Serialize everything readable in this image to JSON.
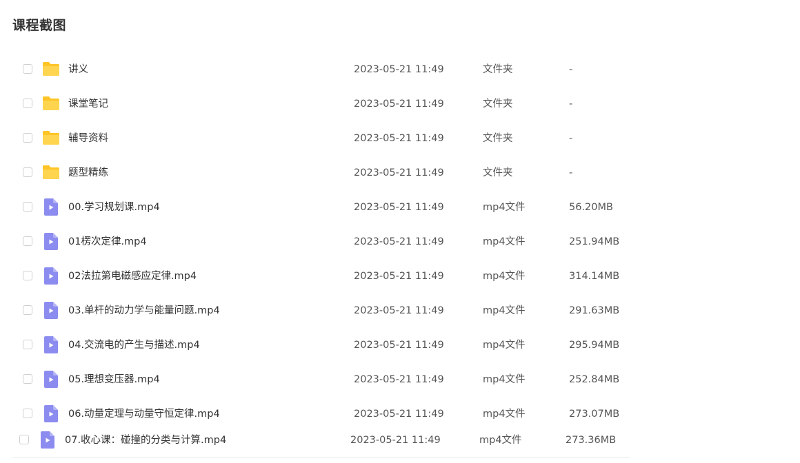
{
  "section": {
    "title": "课程截图"
  },
  "icons": {
    "folder": "folder-icon",
    "video": "video-file-icon",
    "folder_color": "#FFCA28",
    "video_color": "#8C8CF0"
  },
  "files": [
    {
      "name": "讲义",
      "date": "2023-05-21 11:49",
      "type": "文件夹",
      "size": "-",
      "kind": "folder"
    },
    {
      "name": "课堂笔记",
      "date": "2023-05-21 11:49",
      "type": "文件夹",
      "size": "-",
      "kind": "folder"
    },
    {
      "name": "辅导资料",
      "date": "2023-05-21 11:49",
      "type": "文件夹",
      "size": "-",
      "kind": "folder"
    },
    {
      "name": "题型精练",
      "date": "2023-05-21 11:49",
      "type": "文件夹",
      "size": "-",
      "kind": "folder"
    },
    {
      "name": "00.学习规划课.mp4",
      "date": "2023-05-21 11:49",
      "type": "mp4文件",
      "size": "56.20MB",
      "kind": "video"
    },
    {
      "name": "01楞次定律.mp4",
      "date": "2023-05-21 11:49",
      "type": "mp4文件",
      "size": "251.94MB",
      "kind": "video"
    },
    {
      "name": "02法拉第电磁感应定律.mp4",
      "date": "2023-05-21 11:49",
      "type": "mp4文件",
      "size": "314.14MB",
      "kind": "video"
    },
    {
      "name": "03.单杆的动力学与能量问题.mp4",
      "date": "2023-05-21 11:49",
      "type": "mp4文件",
      "size": "291.63MB",
      "kind": "video"
    },
    {
      "name": "04.交流电的产生与描述.mp4",
      "date": "2023-05-21 11:49",
      "type": "mp4文件",
      "size": "295.94MB",
      "kind": "video"
    },
    {
      "name": "05.理想变压器.mp4",
      "date": "2023-05-21 11:49",
      "type": "mp4文件",
      "size": "252.84MB",
      "kind": "video"
    },
    {
      "name": "06.动量定理与动量守恒定律.mp4",
      "date": "2023-05-21 11:49",
      "type": "mp4文件",
      "size": "273.07MB",
      "kind": "video"
    },
    {
      "name": "07.收心课：碰撞的分类与计算.mp4",
      "date": "2023-05-21 11:49",
      "type": "mp4文件",
      "size": "273.36MB",
      "kind": "video"
    }
  ]
}
